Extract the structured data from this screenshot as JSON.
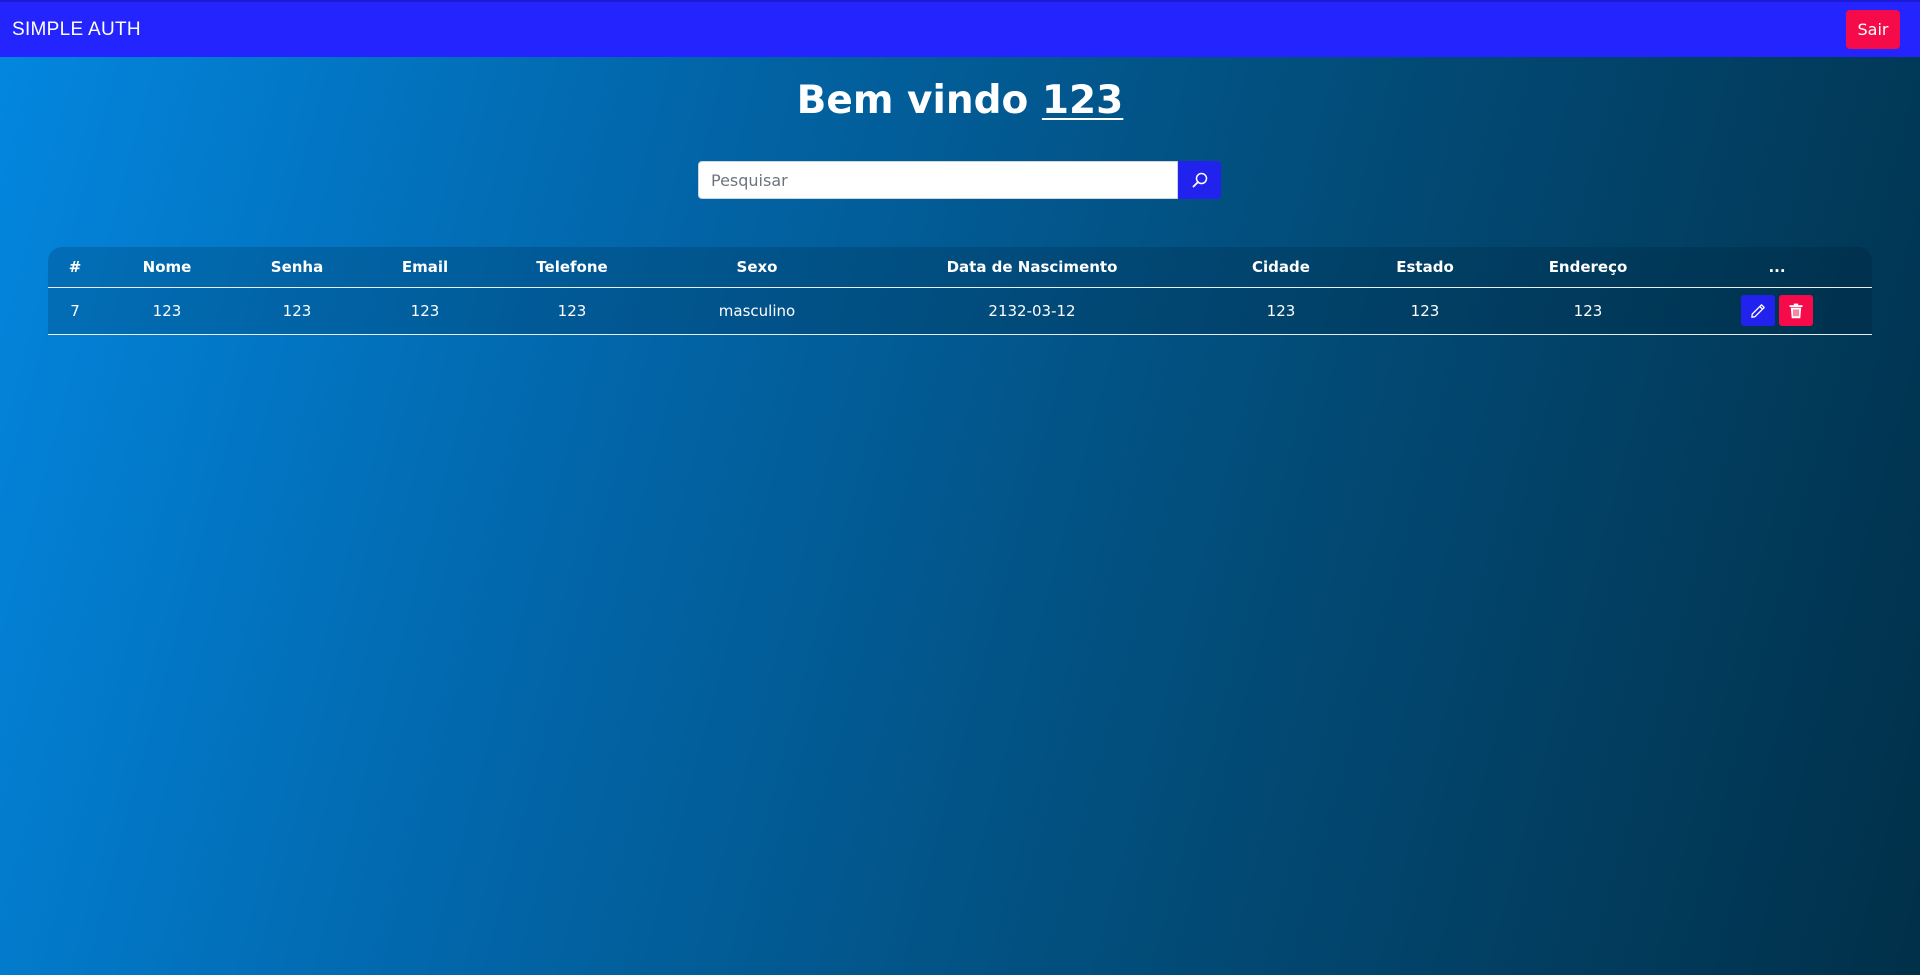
{
  "navbar": {
    "brand": "SIMPLE AUTH",
    "logout_label": "Sair"
  },
  "header": {
    "welcome_prefix": "Bem vindo",
    "username": "123"
  },
  "search": {
    "placeholder": "Pesquisar",
    "value": "",
    "button_icon": "search-icon"
  },
  "table": {
    "columns": [
      "#",
      "Nome",
      "Senha",
      "Email",
      "Telefone",
      "Sexo",
      "Data de Nascimento",
      "Cidade",
      "Estado",
      "Endereço",
      "..."
    ],
    "rows": [
      {
        "id": "7",
        "nome": "123",
        "senha": "123",
        "email": "123",
        "telefone": "123",
        "sexo": "masculino",
        "nascimento": "2132-03-12",
        "cidade": "123",
        "estado": "123",
        "endereco": "123",
        "actions": [
          "pencil-icon",
          "trash-icon"
        ]
      }
    ]
  },
  "colors": {
    "navbar": "#2424ff",
    "primary_button": "#2222ee",
    "danger_button": "#f50a4a",
    "bg_gradient_start": "#0387e0",
    "bg_gradient_end": "#013049"
  }
}
